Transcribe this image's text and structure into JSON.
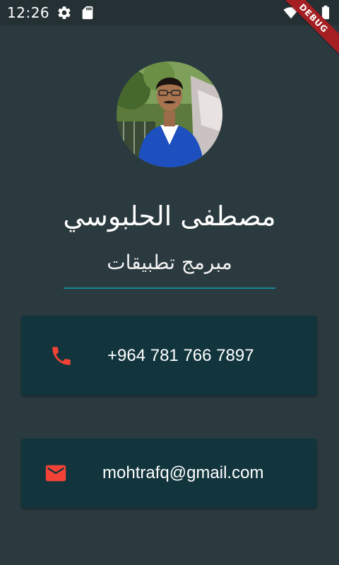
{
  "status_bar": {
    "time": "12:26",
    "icons": [
      "settings-icon",
      "sd-card-icon",
      "wifi-icon",
      "battery-icon"
    ],
    "debug_label": "DEBUG"
  },
  "profile": {
    "avatar": "avatar-photo",
    "name": "مصطفى الحلبوسي",
    "title": "مبرمج تطبيقات"
  },
  "contacts": [
    {
      "icon": "phone-icon",
      "value": "+964 781 766 7897"
    },
    {
      "icon": "email-icon",
      "value": "mohtrafq@gmail.com"
    }
  ],
  "colors": {
    "background": "#2b3a3f",
    "card": "#12353d",
    "divider": "#168a98",
    "icon_accent": "#f44336",
    "debug_ribbon": "#a41e22"
  }
}
